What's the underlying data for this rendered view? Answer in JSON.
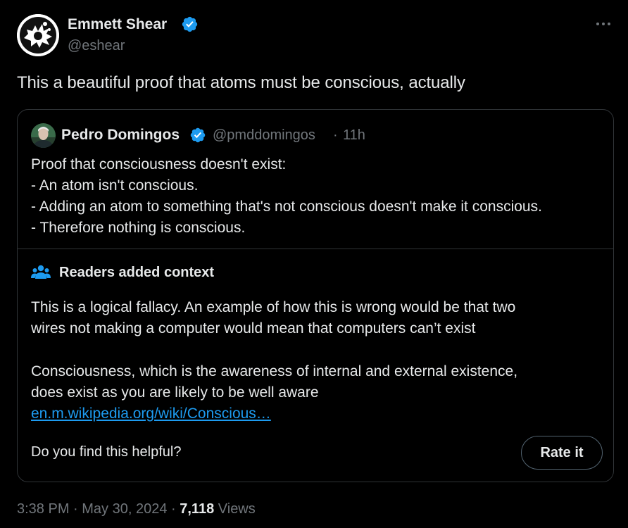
{
  "tweet": {
    "author": {
      "name": "Emmett Shear",
      "handle": "@eshear",
      "verified": true
    },
    "text": "This a beautiful proof that atoms must be conscious, actually",
    "timestamp": "3:38 PM · May 30, 2024",
    "separator": "·",
    "views_count": "7,118",
    "views_label": "Views"
  },
  "quoted": {
    "author": {
      "name": "Pedro Domingos",
      "handle": "@pmddomingos",
      "verified": true
    },
    "separator": "·",
    "time": "11h",
    "lines": [
      "Proof that consciousness doesn't exist:",
      "- An atom isn't conscious.",
      "- Adding an atom to something that's not conscious doesn't make it conscious.",
      "- Therefore nothing is conscious."
    ]
  },
  "community_note": {
    "title": "Readers added context",
    "paragraph1": [
      "This is a logical fallacy. An example of how this is wrong would be that two",
      "wires not making a computer would mean that computers can’t exist"
    ],
    "paragraph2": [
      "Consciousness, which is the awareness of internal and external existence,",
      "does exist as you are likely to be well aware"
    ],
    "link": "en.m.wikipedia.org/wiki/Conscious…",
    "helpful_question": "Do you find this helpful?",
    "rate_button": "Rate it"
  },
  "icons": {
    "verified": "verified-badge-icon",
    "more": "more-horizontal-icon",
    "note": "people-icon"
  },
  "colors": {
    "background": "#000000",
    "text_primary": "#e7e9ea",
    "text_secondary": "#71767b",
    "accent": "#1d9bf0",
    "border": "#2f3336"
  }
}
